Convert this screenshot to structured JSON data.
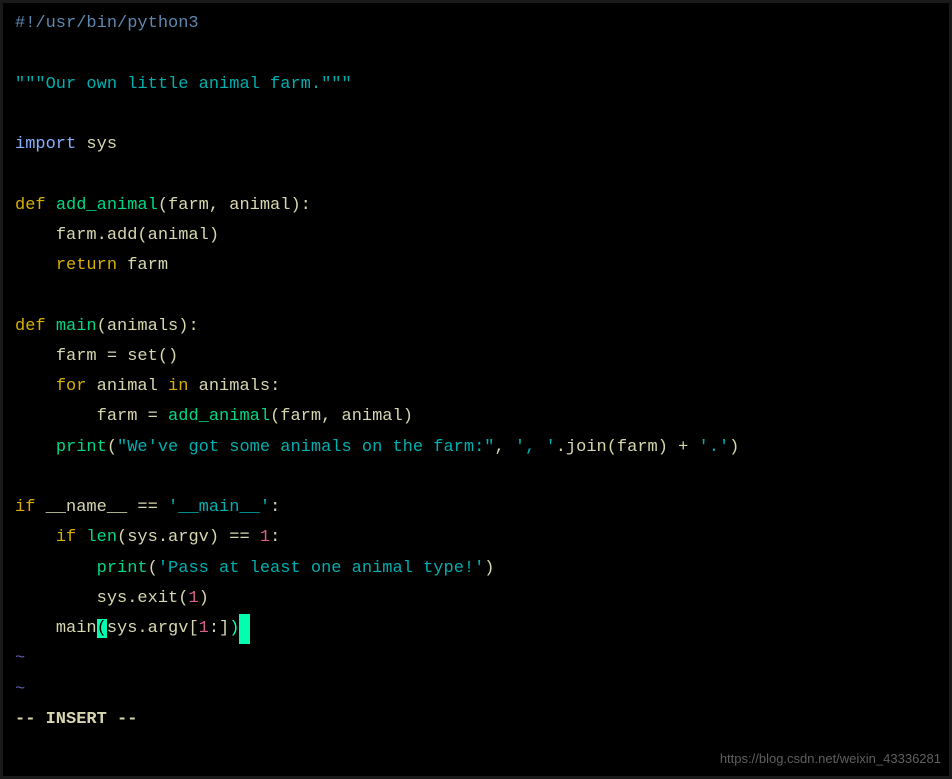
{
  "code": {
    "shebang": "#!/usr/bin/python3",
    "docstring_q": "\"\"\"",
    "docstring_text": "Our own little animal farm.",
    "import_kw": "import",
    "mod_sys": "sys",
    "def_kw": "def",
    "fn_add_animal": "add_animal",
    "args_add": "(farm, animal):",
    "body_add1": "farm.add(animal)",
    "return_kw": "return",
    "return_val": "farm",
    "fn_main": "main",
    "args_main": "(animals):",
    "main_l1": "farm = set()",
    "for_kw": "for",
    "for_mid": " animal ",
    "in_kw": "in",
    "for_end": " animals:",
    "main_l3a": "farm = ",
    "main_l3call": "add_animal",
    "main_l3args": "(farm, animal)",
    "print_kw": "print",
    "print_paren_o": "(",
    "print_str1": "\"We've got some animals on the farm:\"",
    "print_mid": ", ",
    "print_str2": "', '",
    "print_join": ".join(farm) + ",
    "print_str3": "'.'",
    "print_paren_c": ")",
    "if_kw": "if",
    "name_dunder": "__name__",
    "eq": " == ",
    "main_str": "'__main__'",
    "colon": ":",
    "len_fn": "len",
    "argv_expr": "(sys.argv) == ",
    "one": "1",
    "err_str": "'Pass at least one animal type!'",
    "exit_expr": "sys.exit(",
    "exit_c": ")",
    "call_main": "main",
    "slice_open": "(",
    "slice_body": "sys.argv[",
    "slice_num": "1",
    "slice_tail": ":]",
    "slice_close": ")"
  },
  "tilde": "~",
  "mode": "-- INSERT --",
  "watermark": "https://blog.csdn.net/weixin_43336281"
}
